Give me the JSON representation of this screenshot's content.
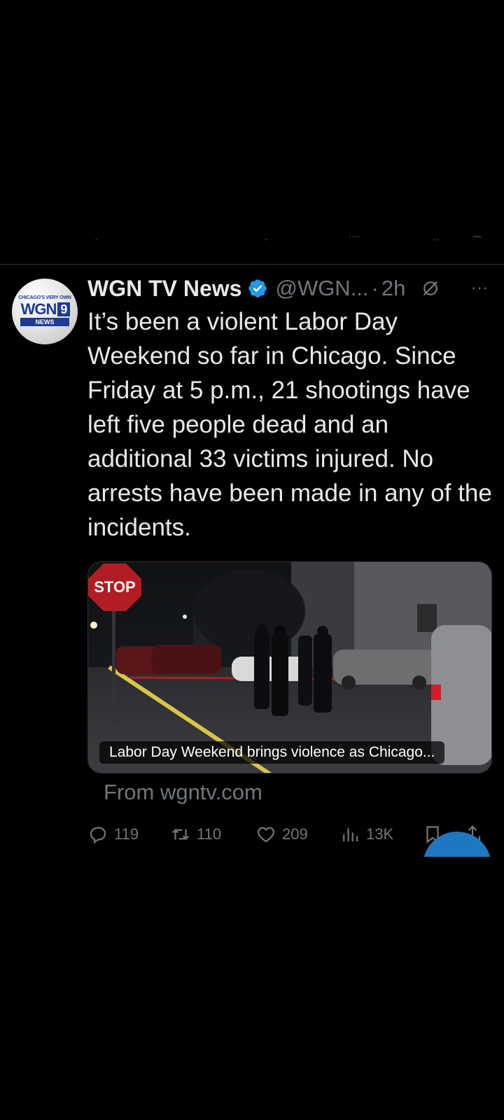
{
  "tweet": {
    "display_name": "WGN TV News",
    "handle": "@WGN...",
    "separator": "·",
    "time": "2h",
    "more": "···",
    "text": "It’s been a violent Labor Day Weekend so far in Chicago. Since Friday at 5 p.m., 21 shootings have left five people dead and an additional 33 victims injured. No arrests have been made in any of the incidents.",
    "avatar": {
      "tagline": "CHICAGO'S VERY OWN",
      "logo": "WGN",
      "channel": "9",
      "sub": "NEWS"
    },
    "card": {
      "caption": "Labor Day Weekend brings violence as Chicago...",
      "sign_text": "STOP",
      "source": "From wgntv.com"
    },
    "actions": {
      "replies": "119",
      "reposts": "110",
      "likes": "209",
      "views": "13K"
    }
  },
  "colors": {
    "background": "#000000",
    "text": "#e7e9ea",
    "muted": "#71767b",
    "verified": "#1d9bf0",
    "fab": "#1d78c1"
  },
  "icons": [
    "verified-badge-icon",
    "grok-icon",
    "more-icon",
    "reply-icon",
    "repost-icon",
    "like-icon",
    "views-icon",
    "bookmark-icon",
    "share-icon"
  ]
}
